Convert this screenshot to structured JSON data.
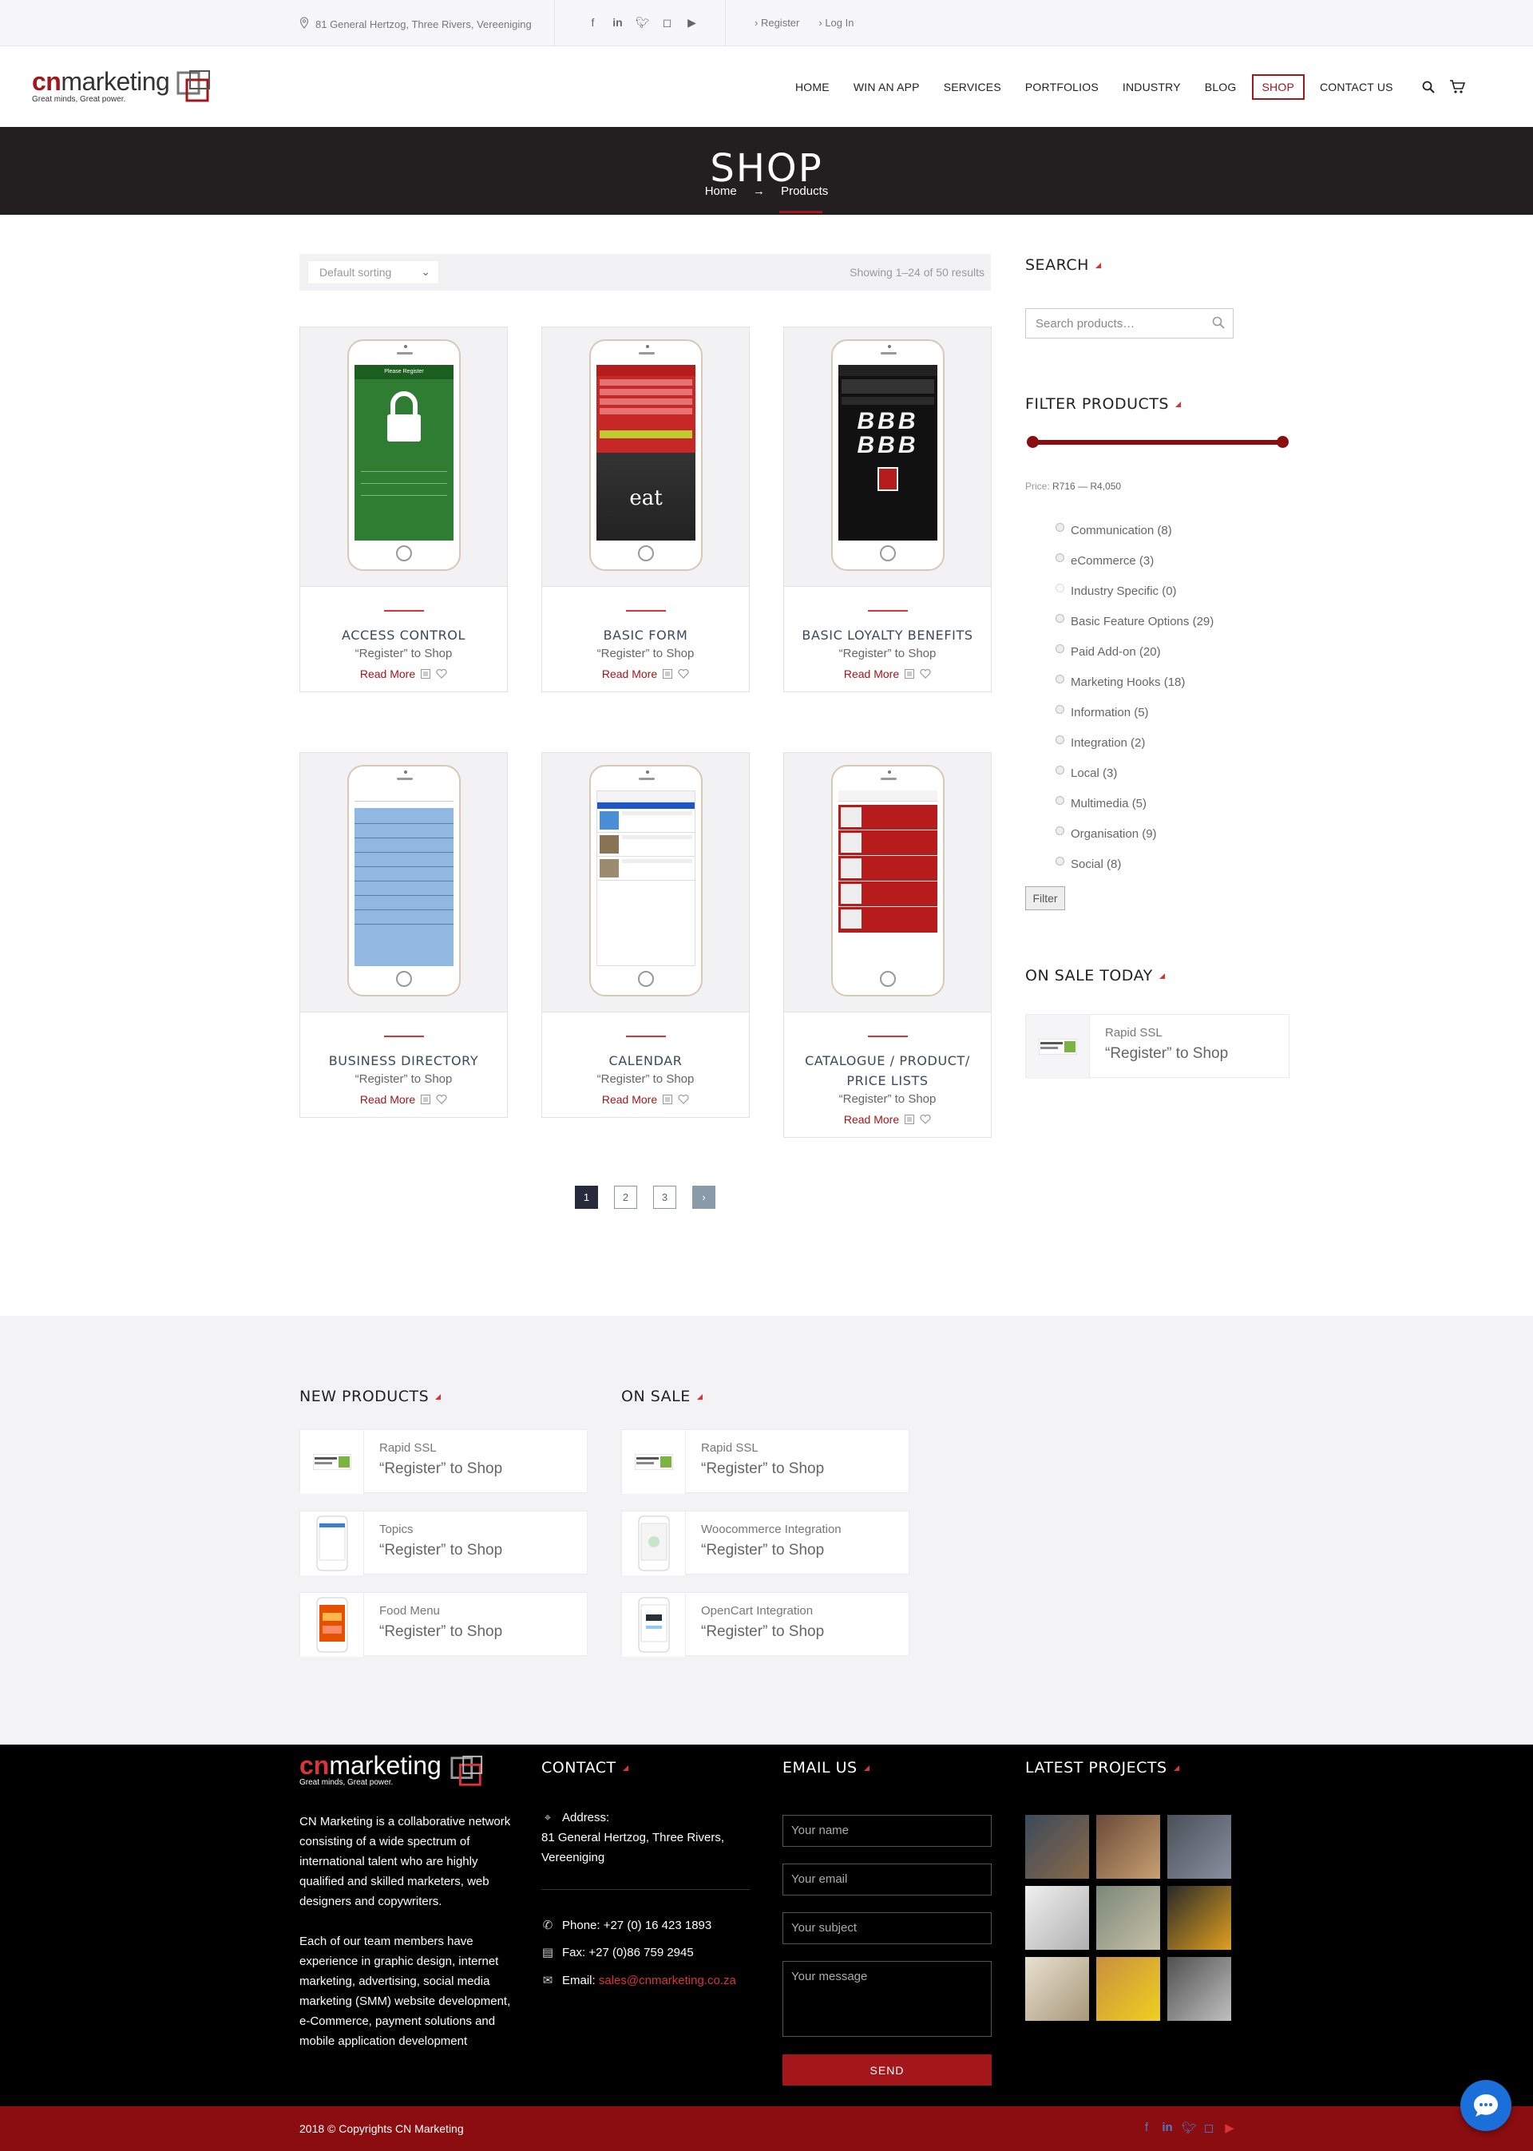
{
  "topbar": {
    "address": "81 General Hertzog, Three Rivers, Vereeniging",
    "social": [
      "facebook-icon",
      "linkedin-icon",
      "twitter-icon",
      "instagram-icon",
      "youtube-icon"
    ],
    "register": "Register",
    "login": "Log In"
  },
  "header": {
    "logo_cn": "cn",
    "logo_marketing": "marketing",
    "logo_tagline": "Great minds, Great power.",
    "nav": [
      "HOME",
      "WIN AN APP",
      "SERVICES",
      "PORTFOLIOS",
      "INDUSTRY",
      "BLOG",
      "SHOP",
      "CONTACT US"
    ],
    "active_nav": "SHOP"
  },
  "hero": {
    "title": "SHOP",
    "crumb_home": "Home",
    "crumb_arrow": "→",
    "crumb_current": "Products"
  },
  "shop": {
    "sort_label": "Default sorting",
    "result_count": "Showing 1–24 of 50 results",
    "read_more": "Read More",
    "products": [
      {
        "title": "ACCESS CONTROL",
        "price": "“Register” to Shop"
      },
      {
        "title": "BASIC FORM",
        "price": "“Register” to Shop"
      },
      {
        "title": "BASIC LOYALTY BENEFITS",
        "price": "“Register” to Shop"
      },
      {
        "title": "BUSINESS DIRECTORY",
        "price": "“Register” to Shop"
      },
      {
        "title": "CALENDAR",
        "price": "“Register” to Shop"
      },
      {
        "title": "CATALOGUE / PRODUCT/ PRICE LISTS",
        "price": "“Register” to Shop"
      }
    ],
    "pages": [
      "1",
      "2",
      "3"
    ],
    "current_page": "1"
  },
  "sidebar": {
    "search_title": "SEARCH",
    "search_placeholder": "Search products…",
    "filter_title": "FILTER PRODUCTS",
    "price_label": "Price:",
    "price_range": "R716 — R4,050",
    "categories": [
      "Communication (8)",
      "eCommerce (3)",
      "Industry Specific (0)",
      "Basic Feature Options (29)",
      "Paid Add-on (20)",
      "Marketing Hooks (18)",
      "Information (5)",
      "Integration (2)",
      "Local (3)",
      "Multimedia (5)",
      "Organisation (9)",
      "Social (8)"
    ],
    "filter_button": "Filter",
    "onsale_title": "ON SALE TODAY",
    "onsale_item": {
      "name": "Rapid SSL",
      "price": "“Register” to Shop"
    }
  },
  "widgets": {
    "new_title": "NEW PRODUCTS",
    "sale_title": "ON SALE",
    "new_products": [
      {
        "name": "Rapid SSL",
        "price": "“Register” to Shop"
      },
      {
        "name": "Topics",
        "price": "“Register” to Shop"
      },
      {
        "name": "Food Menu",
        "price": "“Register” to Shop"
      }
    ],
    "sale_products": [
      {
        "name": "Rapid SSL",
        "price": "“Register” to Shop"
      },
      {
        "name": "Woocommerce Integration",
        "price": "“Register” to Shop"
      },
      {
        "name": "OpenCart Integration",
        "price": "“Register” to Shop"
      }
    ]
  },
  "footer": {
    "about_p1": "CN Marketing is a collaborative network consisting of a wide spectrum of international talent who are highly qualified and skilled marketers, web designers and copywriters.",
    "about_p2": "Each of our team members have experience in graphic design, internet marketing, advertising, social media marketing (SMM) website development, e-Commerce, payment solutions and mobile application development",
    "contact_title": "CONTACT",
    "address_label": "Address:",
    "address": "81 General Hertzog, Three Rivers, Vereeniging",
    "phone": "Phone: +27 (0) 16 423 1893",
    "fax": "Fax: +27 (0)86 759 2945",
    "email_label": "Email:",
    "email": "sales@cnmarketing.co.za",
    "email_title": "EMAIL US",
    "ph_name": "Your name",
    "ph_email": "Your email",
    "ph_subject": "Your subject",
    "ph_message": "Your message",
    "send": "SEND",
    "projects_title": "LATEST PROJECTS",
    "copyright": "2018 © Copyrights CN Marketing"
  },
  "colors": {
    "brand_red": "#a31619",
    "dark": "#231f20",
    "chat_blue": "#1a6fd9"
  }
}
